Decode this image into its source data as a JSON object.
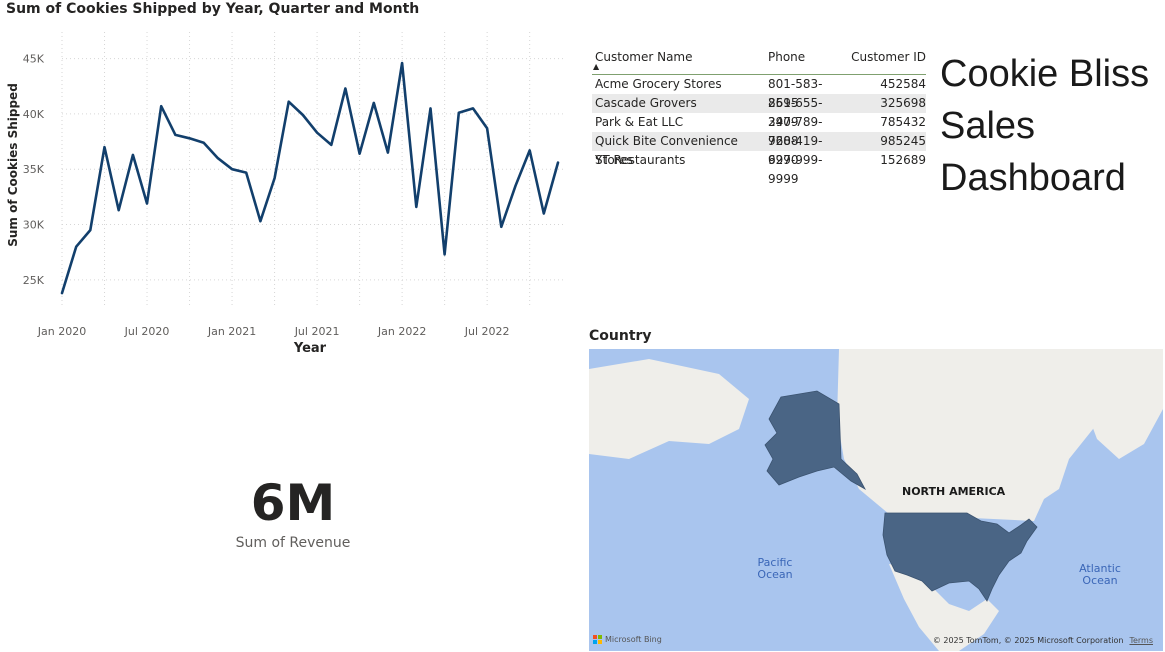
{
  "line_chart": {
    "title": "Sum of Cookies Shipped by Year, Quarter and Month",
    "xlabel": "Year",
    "ylabel": "Sum of Cookies Shipped",
    "line_color": "#123f6c"
  },
  "chart_data": {
    "type": "line",
    "title": "Sum of Cookies Shipped by Year, Quarter and Month",
    "xlabel": "Year",
    "ylabel": "Sum of Cookies Shipped",
    "x_tick_labels": [
      "Jan 2020",
      "Jul 2020",
      "Jan 2021",
      "Jul 2021",
      "Jan 2022",
      "Jul 2022"
    ],
    "y_tick_labels": [
      "25K",
      "30K",
      "35K",
      "40K",
      "45K"
    ],
    "y_ticks": [
      25000,
      30000,
      35000,
      40000,
      45000
    ],
    "ylim": [
      23000,
      46500
    ],
    "grid": true,
    "series": [
      {
        "x": [
          "2020-01",
          "2020-02",
          "2020-03",
          "2020-04",
          "2020-05",
          "2020-06",
          "2020-07",
          "2020-08",
          "2020-09",
          "2020-10",
          "2020-11",
          "2020-12",
          "2021-01",
          "2021-02",
          "2021-03",
          "2021-04",
          "2021-05",
          "2021-06",
          "2021-07",
          "2021-08",
          "2021-09",
          "2021-10",
          "2021-11",
          "2021-12",
          "2022-01",
          "2022-02",
          "2022-03",
          "2022-04",
          "2022-05",
          "2022-06",
          "2022-07",
          "2022-08",
          "2022-09",
          "2022-10",
          "2022-11",
          "2022-12"
        ],
        "values": [
          23800,
          28000,
          29500,
          37000,
          31300,
          36300,
          31900,
          40700,
          38100,
          37800,
          37400,
          36000,
          35000,
          34700,
          30300,
          34200,
          41100,
          39900,
          38300,
          37200,
          42300,
          36400,
          41000,
          36500,
          44600,
          31600,
          40500,
          27300,
          40100,
          40500,
          38700,
          29800,
          33500,
          36700,
          31000,
          35600
        ]
      }
    ]
  },
  "table": {
    "headers": [
      "Customer Name",
      "Phone",
      "Customer ID"
    ],
    "sort_indicator": "▲",
    "rows": [
      [
        "Acme Grocery Stores",
        "801-583-8695",
        "452584"
      ],
      [
        "Cascade Grovers",
        "251-655-2909",
        "325698"
      ],
      [
        "Park & Eat LLC",
        "347-789-7688",
        "785432"
      ],
      [
        "Quick Bite Convenience Stores",
        "920-419-6270",
        "985245"
      ],
      [
        "YT Restaurants",
        "999-999-9999",
        "152689"
      ]
    ]
  },
  "dashboard_title": {
    "line1": "Cookie Bliss",
    "line2": "Sales",
    "line3": "Dashboard"
  },
  "kpi": {
    "value": "6M",
    "label": "Sum of Revenue"
  },
  "map": {
    "title": "Country",
    "region_label": "NORTH AMERICA",
    "pacific_line1": "Pacific",
    "pacific_line2": "Ocean",
    "atlantic_line1": "Atlantic",
    "atlantic_line2": "Ocean",
    "provider": "Microsoft Bing",
    "copyright": "© 2025 TomTom, © 2025 Microsoft Corporation",
    "terms": "Terms",
    "highlight_color": "#4a6585",
    "ocean_color": "#a9c5ee",
    "land_color": "#efeeea"
  }
}
